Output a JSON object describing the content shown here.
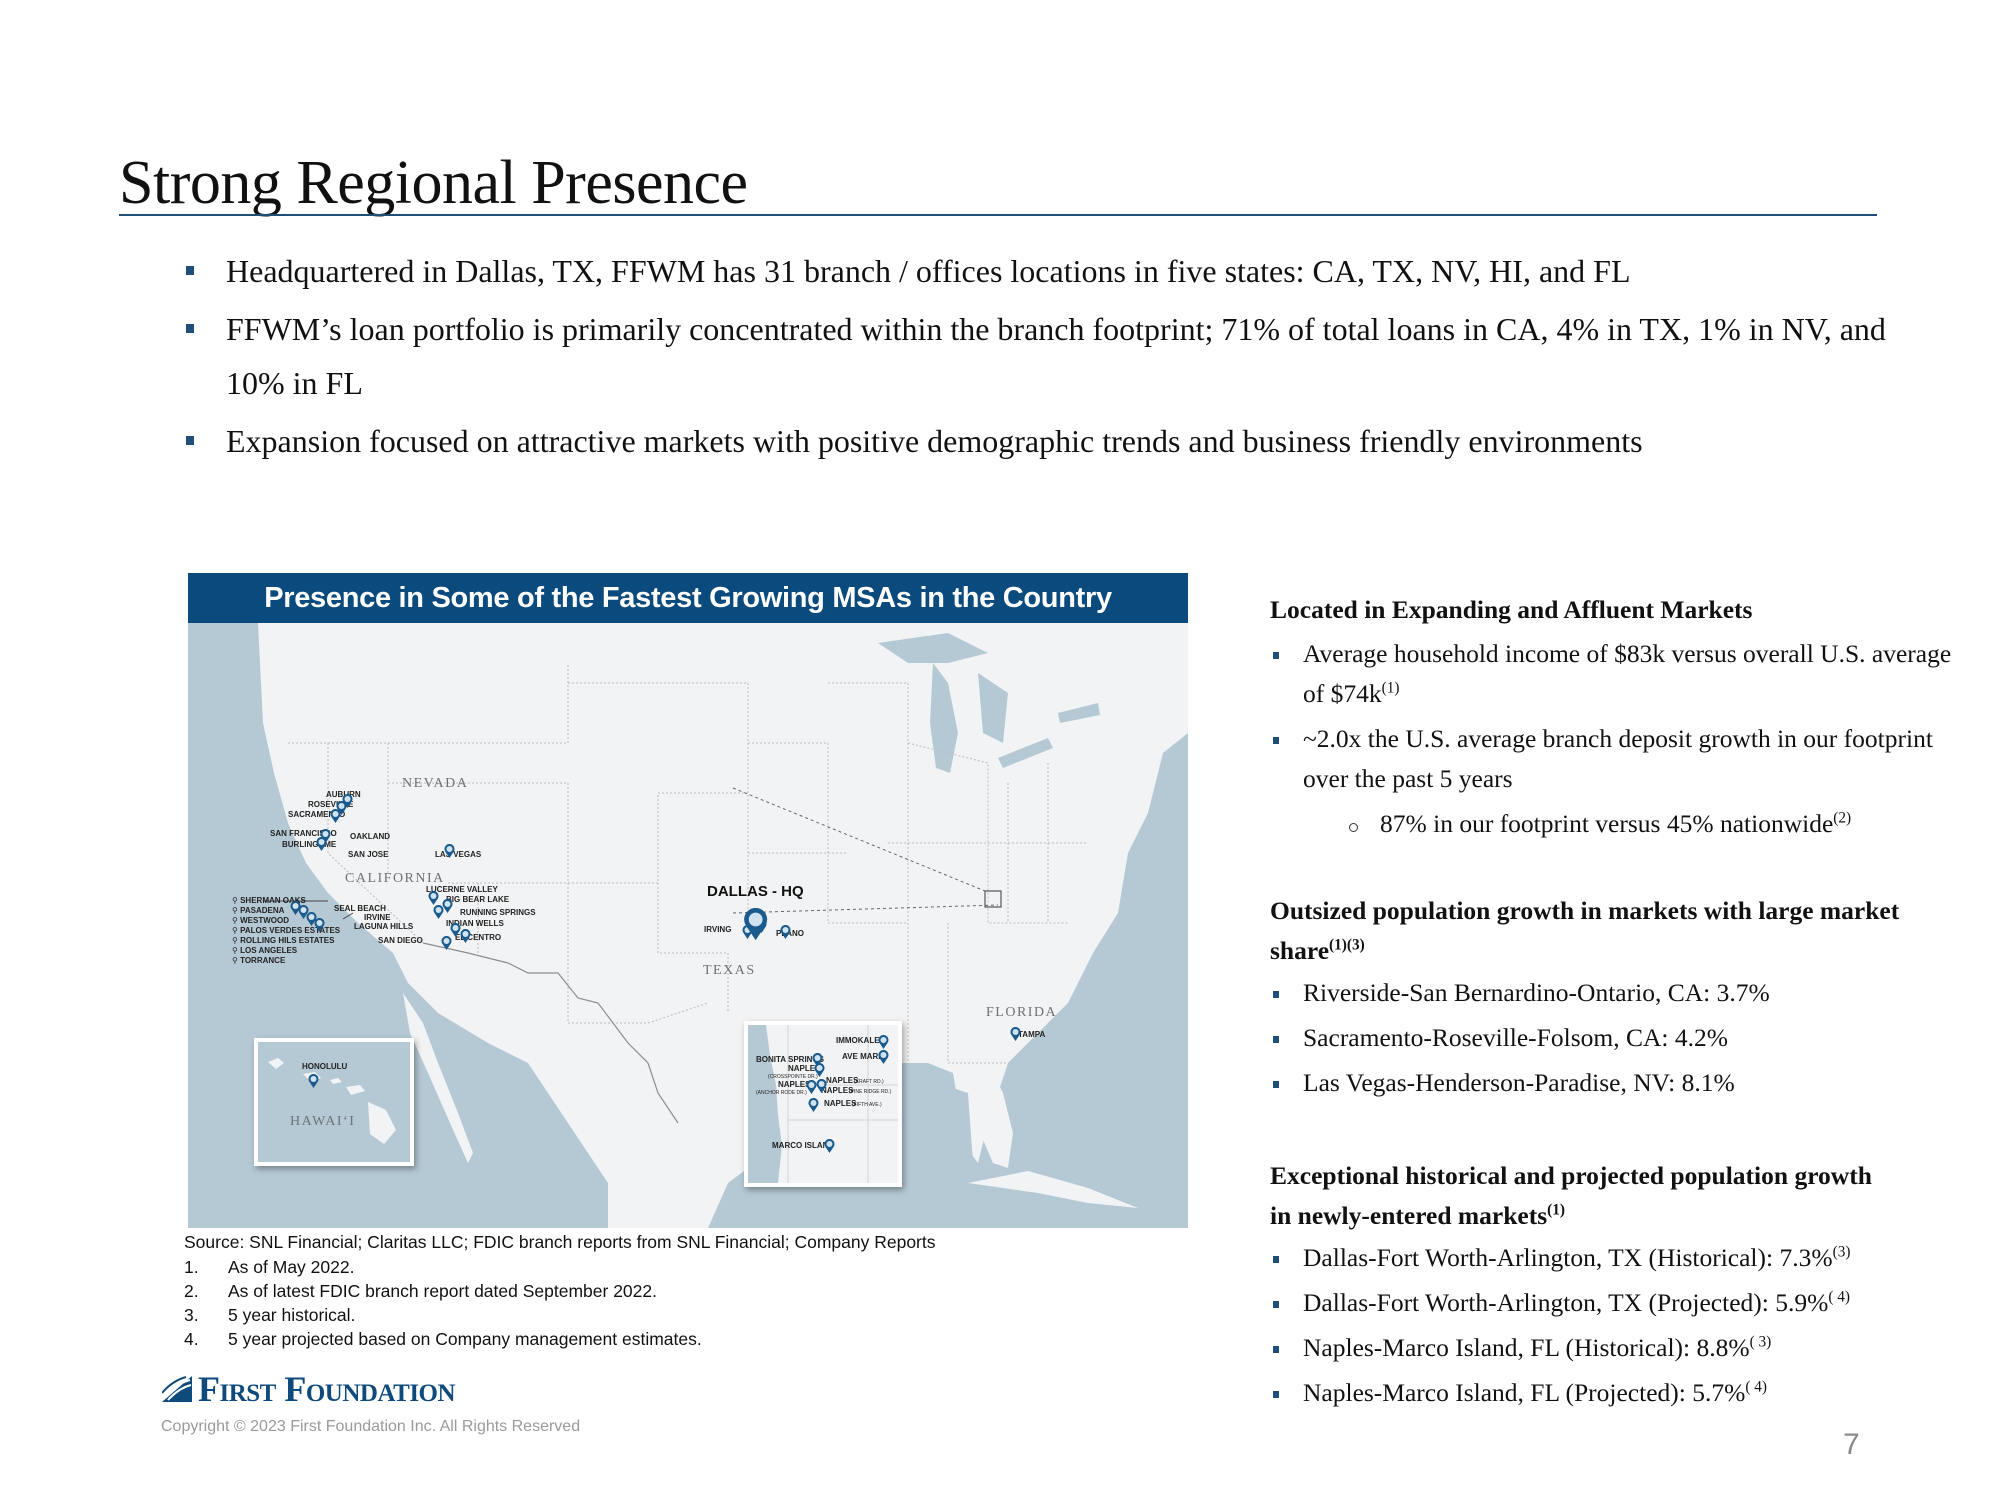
{
  "slide": {
    "title": "Strong Regional Presence",
    "page_number": "7",
    "accent_color": "#1f4e79",
    "header_color": "#0b4a7c"
  },
  "top_bullets": [
    {
      "text": "Headquartered in Dallas, TX, FFWM has 31 branch / offices locations in five states: CA, TX, NV, HI, and FL"
    },
    {
      "text": "FFWM’s loan portfolio is primarily concentrated within the branch footprint; 71% of total loans in CA, 4% in TX, 1% in NV, and 10% in FL"
    },
    {
      "text": "Expansion focused on attractive markets with positive demographic trends and business friendly environments"
    }
  ],
  "map": {
    "header": "Presence in Some of the Fastest Growing MSAs in the Country",
    "state_labels": {
      "nevada": "NEVADA",
      "california": "CALIFORNIA",
      "texas": "TEXAS",
      "florida": "FLORIDA",
      "hawaii": "HAWAI‘I"
    },
    "hq_label": "DALLAS - HQ",
    "locations": {
      "auburn": "AUBURN",
      "roseville": "ROSEVILLE",
      "sacramento": "SACRAMENTO",
      "san_francisco": "SAN FRANCISCO",
      "oakland": "OAKLAND",
      "burlingame": "BURLINGAME",
      "san_jose": "SAN JOSE",
      "las_vegas": "LAS VEGAS",
      "lucerne_valley": "LUCERNE VALLEY",
      "big_bear_lake": "BIG BEAR LAKE",
      "running_springs": "RUNNING SPRINGS",
      "seal_beach": "SEAL BEACH",
      "irvine": "IRVINE",
      "laguna_hills": "LAGUNA HILLS",
      "indian_wells": "INDIAN WELLS",
      "el_centro": "EL CENTRO",
      "san_diego": "SAN DIEGO",
      "irving": "IRVING",
      "plano": "PLANO",
      "tampa": "TAMPA",
      "honolulu": "HONOLULU"
    },
    "la_list": [
      "SHERMAN OAKS",
      "PASADENA",
      "WESTWOOD",
      "PALOS VERDES ESTATES",
      "ROLLING HILS ESTATES",
      "LOS ANGELES",
      "TORRANCE"
    ],
    "florida_inset": {
      "immokalee": "IMMOKALEE",
      "ave_maria": "AVE MARIA",
      "bonita_springs": "BONITA SPRINGS",
      "naples_crosspointe": "NAPLES",
      "naples_crosspointe_sub": "(CROSSPOINTE DR.)",
      "naples_anchor": "NAPLES",
      "naples_anchor_sub": "(ANCHOR RODE DR.)",
      "naples_kraft": "NAPLES",
      "naples_kraft_sub": "(KRAFT RD.)",
      "naples_pine": "NAPLES",
      "naples_pine_sub": "(PINE RIDGE RD.)",
      "naples_fifth": "NAPLES",
      "naples_fifth_sub": "(FIFTH AVE.)",
      "marco_island": "MARCO ISLAND"
    }
  },
  "footnotes": {
    "source": "Source: SNL Financial; Claritas LLC; FDIC branch reports from SNL Financial; Company Reports",
    "items": [
      {
        "num": "1.",
        "text": "As of May 2022."
      },
      {
        "num": "2.",
        "text": "As of latest FDIC branch report dated September 2022."
      },
      {
        "num": "3.",
        "text": "5 year historical."
      },
      {
        "num": "4.",
        "text": "5 year projected based on Company management estimates."
      }
    ]
  },
  "brand": {
    "logo_text": "First Foundation",
    "copyright": "Copyright © 2023 First Foundation Inc. All Rights Reserved"
  },
  "right_column": {
    "section1": {
      "heading": "Located in Expanding and Affluent Markets",
      "b1": "Average household income of $83k versus overall U.S. average of $74k",
      "b1_sup": "(1)",
      "b2": "~2.0x the U.S. average branch deposit growth in our footprint over the past 5 years",
      "b2_sub": "87% in our footprint versus 45% nationwide",
      "b2_sub_sup": "(2)"
    },
    "section2": {
      "heading": "Outsized population growth in markets with large market share",
      "heading_sup": "(1)(3)",
      "items": [
        "Riverside-San Bernardino-Ontario, CA: 3.7%",
        "Sacramento-Roseville-Folsom, CA: 4.2%",
        "Las Vegas-Henderson-Paradise, NV: 8.1%"
      ]
    },
    "section3": {
      "heading": "Exceptional historical and projected population growth in newly-entered markets",
      "heading_sup": "(1)",
      "items": [
        {
          "text": "Dallas-Fort Worth-Arlington, TX (Historical): 7.3%",
          "sup": "(3)"
        },
        {
          "text": "Dallas-Fort Worth-Arlington, TX (Projected): 5.9%",
          "sup": "( 4)"
        },
        {
          "text": "Naples-Marco Island, FL (Historical): 8.8%",
          "sup": "( 3)"
        },
        {
          "text": "Naples-Marco Island, FL (Projected): 5.7%",
          "sup": "( 4)"
        }
      ]
    }
  }
}
